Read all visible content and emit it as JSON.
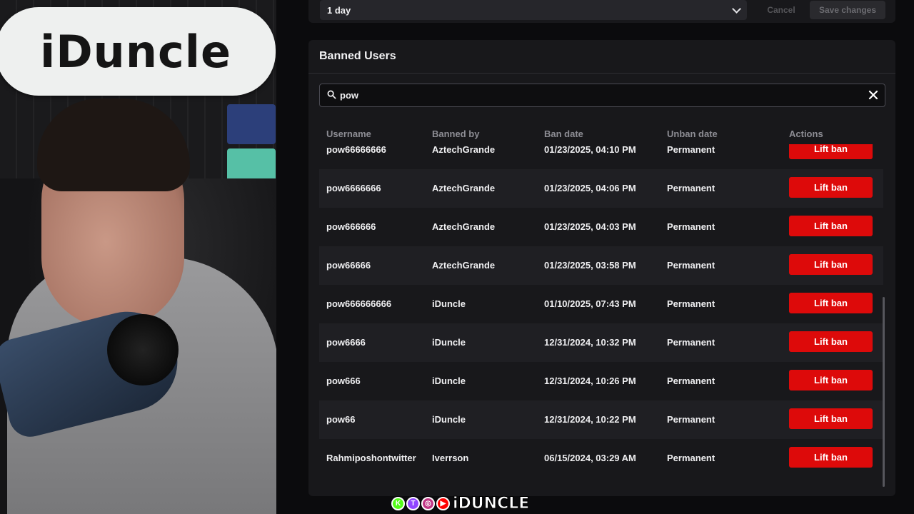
{
  "webcam": {
    "deck_text": "iDuncle"
  },
  "settings": {
    "duration_value": "1 day",
    "cancel_label": "Cancel",
    "save_label": "Save changes"
  },
  "banned_users": {
    "title": "Banned Users",
    "search_value": "pow",
    "columns": [
      "Username",
      "Banned by",
      "Ban date",
      "Unban date",
      "Actions"
    ],
    "rows": [
      {
        "username": "pow66666666",
        "banned_by": "AztechGrande",
        "ban_date": "01/23/2025, 04:10 PM",
        "unban_date": "Permanent",
        "action": "Lift ban"
      },
      {
        "username": "pow6666666",
        "banned_by": "AztechGrande",
        "ban_date": "01/23/2025, 04:06 PM",
        "unban_date": "Permanent",
        "action": "Lift ban"
      },
      {
        "username": "pow666666",
        "banned_by": "AztechGrande",
        "ban_date": "01/23/2025, 04:03 PM",
        "unban_date": "Permanent",
        "action": "Lift ban"
      },
      {
        "username": "pow66666",
        "banned_by": "AztechGrande",
        "ban_date": "01/23/2025, 03:58 PM",
        "unban_date": "Permanent",
        "action": "Lift ban"
      },
      {
        "username": "pow666666666",
        "banned_by": "iDuncle",
        "ban_date": "01/10/2025, 07:43 PM",
        "unban_date": "Permanent",
        "action": "Lift ban"
      },
      {
        "username": "pow6666",
        "banned_by": "iDuncle",
        "ban_date": "12/31/2024, 10:32 PM",
        "unban_date": "Permanent",
        "action": "Lift ban"
      },
      {
        "username": "pow666",
        "banned_by": "iDuncle",
        "ban_date": "12/31/2024, 10:26 PM",
        "unban_date": "Permanent",
        "action": "Lift ban"
      },
      {
        "username": "pow66",
        "banned_by": "iDuncle",
        "ban_date": "12/31/2024, 10:22 PM",
        "unban_date": "Permanent",
        "action": "Lift ban"
      },
      {
        "username": "Rahmiposhontwitter",
        "banned_by": "Iverrson",
        "ban_date": "06/15/2024, 03:29 AM",
        "unban_date": "Permanent",
        "action": "Lift ban"
      }
    ]
  },
  "overlay": {
    "brand_text": "iDUNCLE",
    "social_icons": [
      "kick-icon",
      "twitch-icon",
      "instagram-icon",
      "youtube-icon"
    ],
    "social_glyphs": [
      "K",
      "T",
      "◎",
      "▶"
    ],
    "social_colors": [
      "#53fc18",
      "#9146ff",
      "#c13584",
      "#ff0000"
    ]
  },
  "colors": {
    "lift_ban": "#dd0a0a",
    "panel": "#18181b",
    "row_alt": "#1f1f23"
  }
}
